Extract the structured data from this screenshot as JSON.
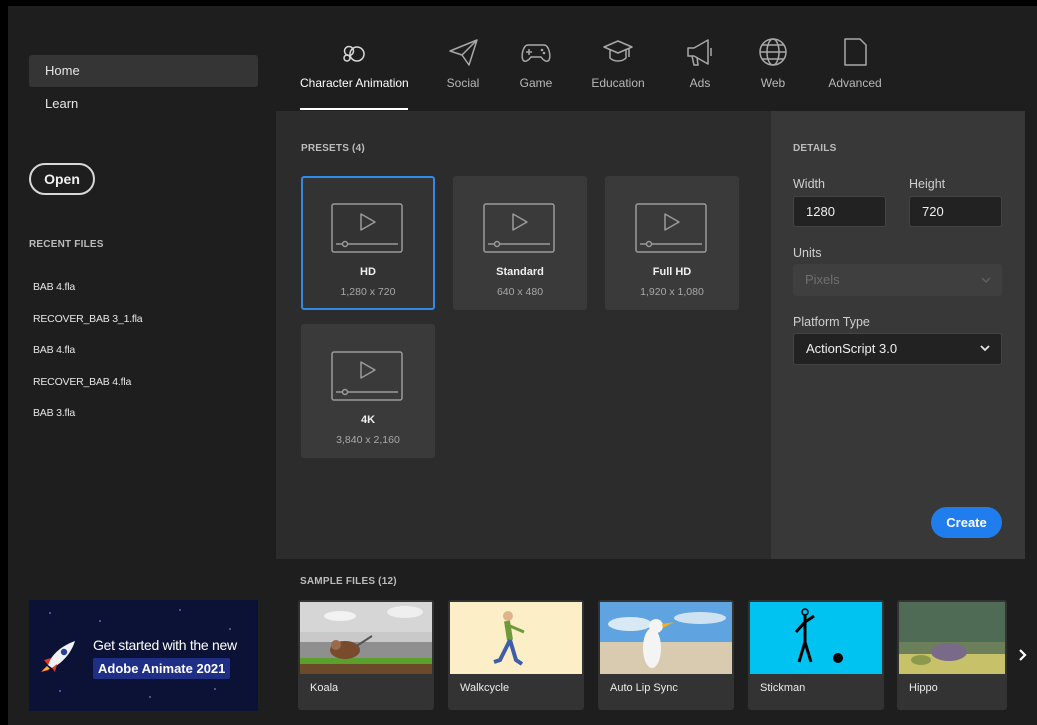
{
  "sidebar": {
    "nav": [
      {
        "label": "Home"
      },
      {
        "label": "Learn"
      }
    ],
    "open_label": "Open",
    "recent_title": "RECENT FILES",
    "recent_files": [
      "BAB 4.fla",
      "RECOVER_BAB 3_1.fla",
      "BAB 4.fla",
      "RECOVER_BAB 4.fla",
      "BAB 3.fla"
    ],
    "promo": {
      "line1": "Get started with the new",
      "line2": "Adobe Animate 2021"
    }
  },
  "tabs": [
    {
      "label": "Character Animation",
      "icon": "character-animation-icon",
      "active": true
    },
    {
      "label": "Social",
      "icon": "paper-plane-icon"
    },
    {
      "label": "Game",
      "icon": "gamepad-icon"
    },
    {
      "label": "Education",
      "icon": "graduation-cap-icon"
    },
    {
      "label": "Ads",
      "icon": "megaphone-icon"
    },
    {
      "label": "Web",
      "icon": "globe-icon"
    },
    {
      "label": "Advanced",
      "icon": "document-icon"
    }
  ],
  "presets": {
    "title": "PRESETS (4)",
    "items": [
      {
        "name": "HD",
        "size": "1,280 x 720",
        "selected": true
      },
      {
        "name": "Standard",
        "size": "640 x 480"
      },
      {
        "name": "Full HD",
        "size": "1,920 x 1,080"
      },
      {
        "name": "4K",
        "size": "3,840 x 2,160"
      }
    ]
  },
  "details": {
    "title": "DETAILS",
    "width_label": "Width",
    "width_value": "1280",
    "height_label": "Height",
    "height_value": "720",
    "units_label": "Units",
    "units_value": "Pixels",
    "platform_label": "Platform Type",
    "platform_value": "ActionScript 3.0",
    "create_label": "Create"
  },
  "samples": {
    "title": "SAMPLE FILES (12)",
    "items": [
      {
        "label": "Koala"
      },
      {
        "label": "Walkcycle"
      },
      {
        "label": "Auto Lip Sync"
      },
      {
        "label": "Stickman"
      },
      {
        "label": "Hippo"
      }
    ]
  },
  "colors": {
    "accent": "#1f7ded",
    "selection_border": "#2d8ceb",
    "background": "#1e1e1e",
    "panel": "#2c2c2c",
    "details_panel": "#383838"
  }
}
